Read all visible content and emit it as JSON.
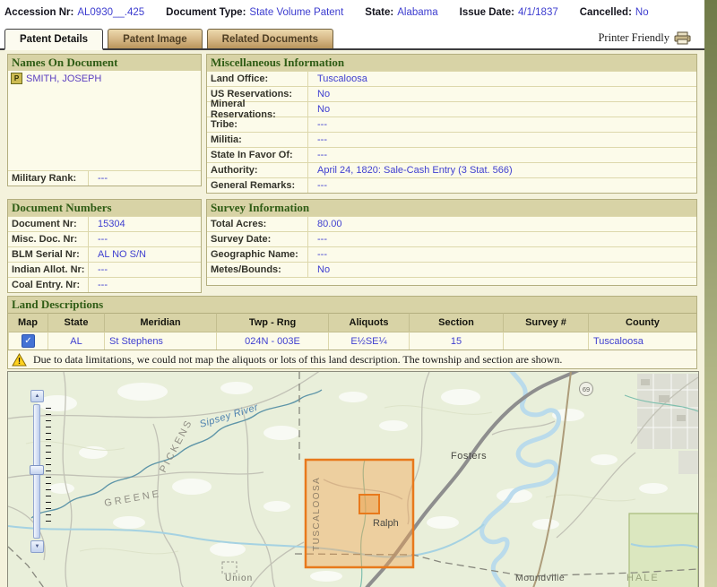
{
  "header": {
    "fields": [
      {
        "label": "Accession Nr:",
        "value": "AL0930__.425"
      },
      {
        "label": "Document Type:",
        "value": "State Volume Patent"
      },
      {
        "label": "State:",
        "value": "Alabama"
      },
      {
        "label": "Issue Date:",
        "value": "4/1/1837"
      },
      {
        "label": "Cancelled:",
        "value": "No"
      }
    ]
  },
  "tabs": [
    {
      "label": "Patent Details",
      "active": true
    },
    {
      "label": "Patent Image",
      "active": false
    },
    {
      "label": "Related Documents",
      "active": false
    }
  ],
  "printer_friendly_label": "Printer Friendly",
  "panels": {
    "names": {
      "title": "Names On Document",
      "patentee_name": "SMITH, JOSEPH",
      "military_rank_label": "Military Rank:",
      "military_rank_value": "---"
    },
    "misc": {
      "title": "Miscellaneous Information",
      "rows": [
        {
          "label": "Land Office:",
          "value": "Tuscaloosa"
        },
        {
          "label": "US Reservations:",
          "value": "No"
        },
        {
          "label": "Mineral Reservations:",
          "value": "No"
        },
        {
          "label": "Tribe:",
          "value": "---"
        },
        {
          "label": "Militia:",
          "value": "---"
        },
        {
          "label": "State In Favor Of:",
          "value": "---"
        },
        {
          "label": "Authority:",
          "value": "April 24, 1820: Sale-Cash Entry (3 Stat. 566)"
        },
        {
          "label": "General Remarks:",
          "value": "---"
        }
      ]
    },
    "docnums": {
      "title": "Document Numbers",
      "rows": [
        {
          "label": "Document Nr:",
          "value": "15304"
        },
        {
          "label": "Misc. Doc. Nr:",
          "value": "---"
        },
        {
          "label": "BLM Serial Nr:",
          "value": "AL NO S/N"
        },
        {
          "label": "Indian Allot. Nr:",
          "value": "---"
        },
        {
          "label": "Coal Entry. Nr:",
          "value": "---"
        }
      ]
    },
    "survey": {
      "title": "Survey Information",
      "rows": [
        {
          "label": "Total Acres:",
          "value": "80.00"
        },
        {
          "label": "Survey Date:",
          "value": "---"
        },
        {
          "label": "Geographic Name:",
          "value": "---"
        },
        {
          "label": "Metes/Bounds:",
          "value": "No"
        }
      ]
    },
    "land": {
      "title": "Land Descriptions",
      "columns": [
        "Map",
        "State",
        "Meridian",
        "Twp - Rng",
        "Aliquots",
        "Section",
        "Survey #",
        "County"
      ],
      "rows": [
        {
          "map_checked": true,
          "state": "AL",
          "meridian": "St Stephens",
          "twp_rng": "024N - 003E",
          "aliquots": "E½SE¼",
          "section": "15",
          "survey_nr": "",
          "county": "Tuscaloosa"
        }
      ]
    }
  },
  "warning": {
    "text": "Due to data limitations, we could not map the aliquots or lots of this land description. The township and section are shown."
  },
  "map": {
    "labels": {
      "sipsey_river": "Sipsey River",
      "pickens": "PICKENS",
      "greene": "GREENE",
      "tuscaloosa": "TUSCALOOSA",
      "ralph": "Ralph",
      "fosters": "Fosters",
      "union": "Union",
      "moundville": "Moundville",
      "hale": "HALE",
      "highway_69": "69"
    }
  },
  "icons": {
    "patentee": "P",
    "check": "✓",
    "zoom_in": "▲",
    "zoom_out": "▼",
    "warning_mark": "!"
  },
  "colors": {
    "township_orange": "#e8791c",
    "section_title_green": "#2f5c15",
    "link_blue": "#4040d0",
    "panel_header_tan": "#d8d3a6",
    "checkbox_blue": "#4472d4"
  }
}
